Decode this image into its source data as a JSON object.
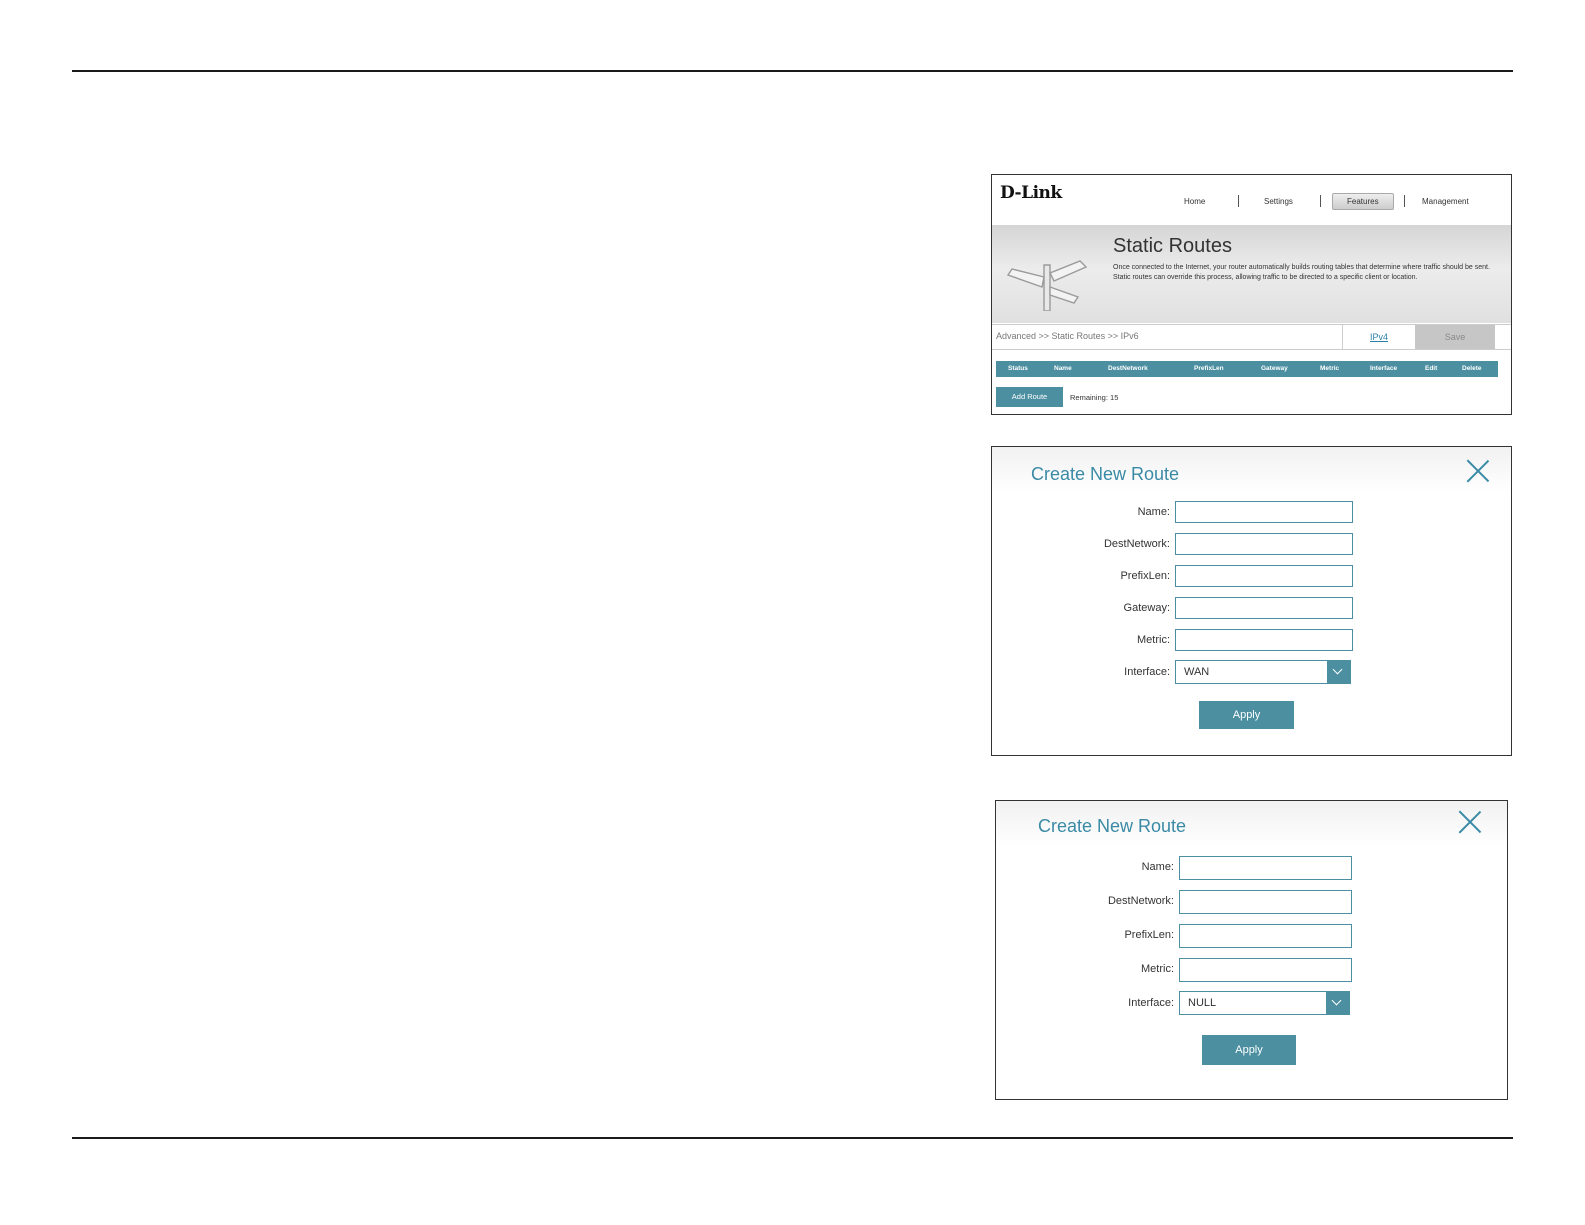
{
  "static_routes": {
    "logo": "D-Link",
    "nav": [
      "Home",
      "Settings",
      "Features",
      "Management"
    ],
    "active_nav": "Features",
    "title": "Static Routes",
    "description": "Once connected to the Internet, your router automatically builds routing tables that determine where traffic should be sent. Static routes can override this process, allowing traffic to be directed to a specific client or location.",
    "breadcrumb": "Advanced >> Static Routes >> IPv6",
    "ipv4_link": "IPv4",
    "save_label": "Save",
    "columns": [
      "Status",
      "Name",
      "DestNetwork",
      "PrefixLen",
      "Gateway",
      "Metric",
      "Interface",
      "Edit",
      "Delete"
    ],
    "add_route_label": "Add Route",
    "remaining": "Remaining: 15"
  },
  "dialog_wan": {
    "title": "Create New Route",
    "labels": {
      "name": "Name:",
      "dest_network": "DestNetwork:",
      "prefix_len": "PrefixLen:",
      "gateway": "Gateway:",
      "metric": "Metric:",
      "interface": "Interface:"
    },
    "interface_value": "WAN",
    "apply_label": "Apply"
  },
  "dialog_null": {
    "title": "Create New Route",
    "labels": {
      "name": "Name:",
      "dest_network": "DestNetwork:",
      "prefix_len": "PrefixLen:",
      "metric": "Metric:",
      "interface": "Interface:"
    },
    "interface_value": "NULL",
    "apply_label": "Apply"
  },
  "colors": {
    "accent": "#4c8fa1",
    "title_blue": "#3a8aa6",
    "save_gray": "#c6c6c6"
  }
}
